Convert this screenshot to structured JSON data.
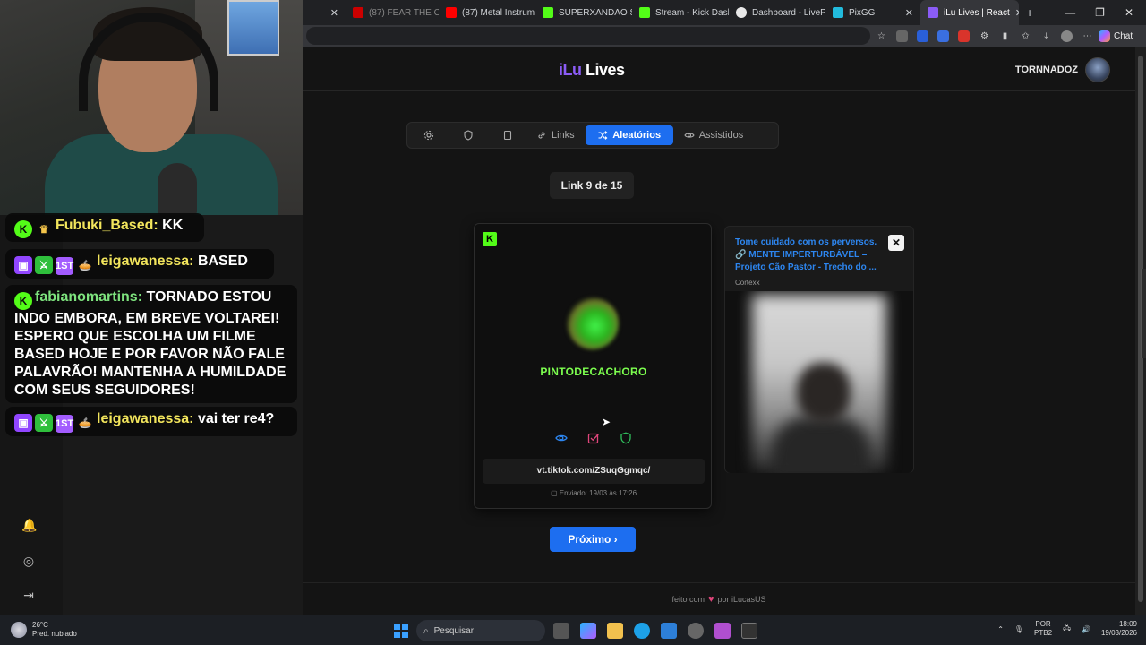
{
  "browser": {
    "tabs": [
      {
        "label": "",
        "favicon_color": "#d44"
      },
      {
        "label": "(87) FEAR THE CLO",
        "favicon_color": "#c00"
      },
      {
        "label": "(87) Metal Instrume",
        "favicon_color": "#f00"
      },
      {
        "label": "SUPERXANDAO Str",
        "favicon_color": "#53fc18"
      },
      {
        "label": "Stream - Kick Dashb",
        "favicon_color": "#53fc18"
      },
      {
        "label": "Dashboard - LivePix",
        "favicon_color": "#e8e8e8"
      },
      {
        "label": "PixGG",
        "favicon_color": "#2bd"
      },
      {
        "label": "iLu Lives | React",
        "favicon_color": "#8b5cf6"
      }
    ],
    "new_tab_label": "+",
    "chat_label": "Chat"
  },
  "stream_chat": {
    "messages": [
      {
        "user": "Fubuki_Based:",
        "text": " KK",
        "color": "yellow"
      },
      {
        "user": "leigawanessa:",
        "text": " BASED",
        "color": "yellow"
      },
      {
        "user": "fabianomartins:",
        "text": " TORNADO ESTOU INDO EMBORA, EM BREVE VOLTAREI! ESPERO QUE ESCOLHA UM FILME BASED HOJE E POR FAVOR NÃO FALE PALAVRÃO! MANTENHA A HUMILDADE COM SEUS SEGUIDORES!",
        "color": "green"
      },
      {
        "user": "leigawanessa:",
        "text": " vai ter re4?",
        "color": "yellow"
      }
    ],
    "first_badge": "1ST"
  },
  "site": {
    "logo_a": "iLu",
    "logo_b": " Lives",
    "username": "TORNNADOZ",
    "nav": {
      "links_label": "Links",
      "random_label": "Aleatórios",
      "watched_label": "Assistidos"
    },
    "counter": "Link 9 de 15",
    "card": {
      "platform_icon": "kick-icon",
      "streamer": "PINTODECACHORO",
      "link": "vt.tiktok.com/ZSuqGgmqc/",
      "sent": "Enviado: 19/03 às 17:26"
    },
    "preview": {
      "title": "Tome cuidado com os perversos. 🔗 MENTE IMPERTURBÁVEL – Projeto Cão Pastor - Trecho do ...",
      "author": "Cortexx",
      "close_label": "✕"
    },
    "next_label": "Próximo ›",
    "footer_a": "feito com",
    "footer_b": "por iLucasUS"
  },
  "taskbar": {
    "temp": "26°C",
    "weather": "Pred. nublado",
    "search_placeholder": "Pesquisar",
    "lang_1": "POR",
    "lang_2": "PTB2",
    "time": "18:09",
    "date": "19/03/2026"
  },
  "colors": {
    "accent": "#1d6ef0",
    "kick_green": "#53fc18",
    "brand_purple": "#8b5cf6"
  }
}
